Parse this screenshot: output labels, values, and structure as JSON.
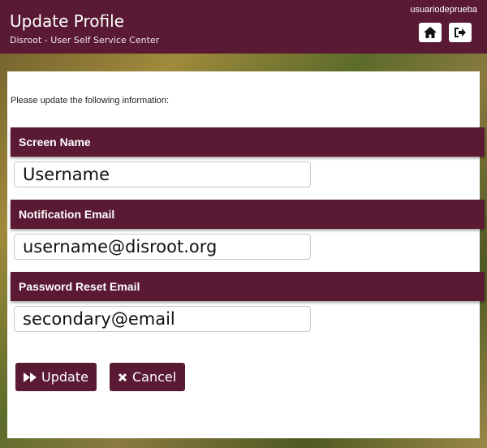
{
  "header": {
    "title": "Update Profile",
    "subtitle": "Disroot - User Self Service Center",
    "username": "usuariodeprueba",
    "home_icon": "home-icon",
    "logout_icon": "logout-icon"
  },
  "form": {
    "intro": "Please update the following information:",
    "sections": [
      {
        "label": "Screen Name",
        "value": "Username"
      },
      {
        "label": "Notification Email",
        "value": "username@disroot.org"
      },
      {
        "label": "Password Reset Email",
        "value": "secondary@email"
      }
    ],
    "update_label": "Update",
    "cancel_label": "Cancel"
  },
  "colors": {
    "brand": "#5a1a33",
    "panel": "#ffffff"
  }
}
